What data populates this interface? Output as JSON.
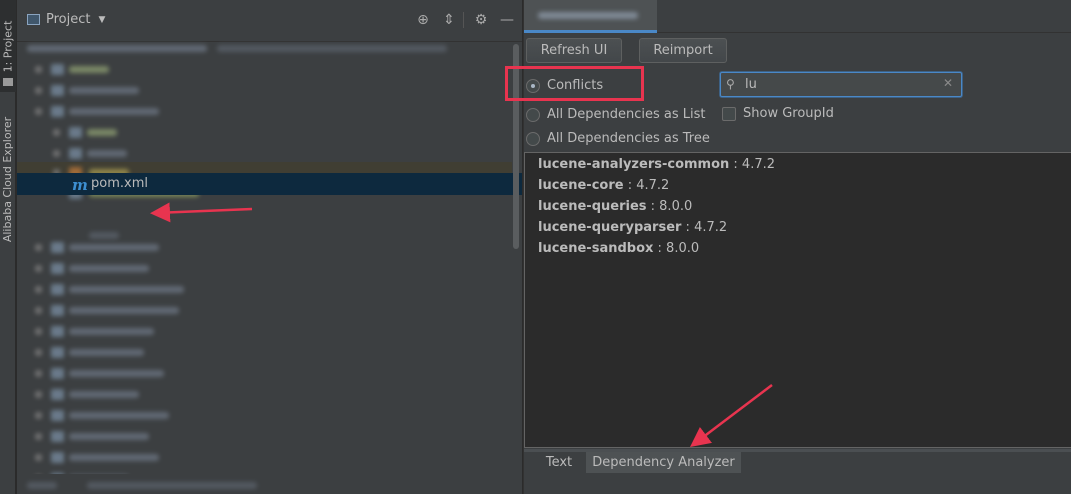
{
  "tool_window_strip": {
    "project_tab": "1: Project",
    "alibaba_tab": "Alibaba Cloud Explorer"
  },
  "project_panel": {
    "title": "Project",
    "selected_file": "pom.xml",
    "selected_file_icon": "maven-m-icon"
  },
  "dependency_analyzer": {
    "buttons": {
      "refresh": "Refresh UI",
      "reimport": "Reimport"
    },
    "view_modes": [
      {
        "label": "Conflicts",
        "selected": true
      },
      {
        "label": "All Dependencies as List",
        "selected": false
      },
      {
        "label": "All Dependencies as Tree",
        "selected": false
      }
    ],
    "search": {
      "value": "lu"
    },
    "show_group_id": {
      "label": "Show GroupId",
      "checked": false
    },
    "dependencies": [
      {
        "name": "lucene-analyzers-common",
        "version": " : 4.7.2"
      },
      {
        "name": "lucene-core",
        "version": " : 4.7.2"
      },
      {
        "name": "lucene-queries",
        "version": " : 8.0.0"
      },
      {
        "name": "lucene-queryparser",
        "version": " : 4.7.2"
      },
      {
        "name": "lucene-sandbox",
        "version": " : 8.0.0"
      }
    ],
    "bottom_tabs": [
      "Text",
      "Dependency Analyzer"
    ],
    "active_bottom_tab": "Dependency Analyzer"
  },
  "colors": {
    "background": "#2b2b2b",
    "panel": "#3c3f41",
    "selection": "#0d293e",
    "accent": "#4a88c7",
    "annotation": "#e8344f"
  }
}
